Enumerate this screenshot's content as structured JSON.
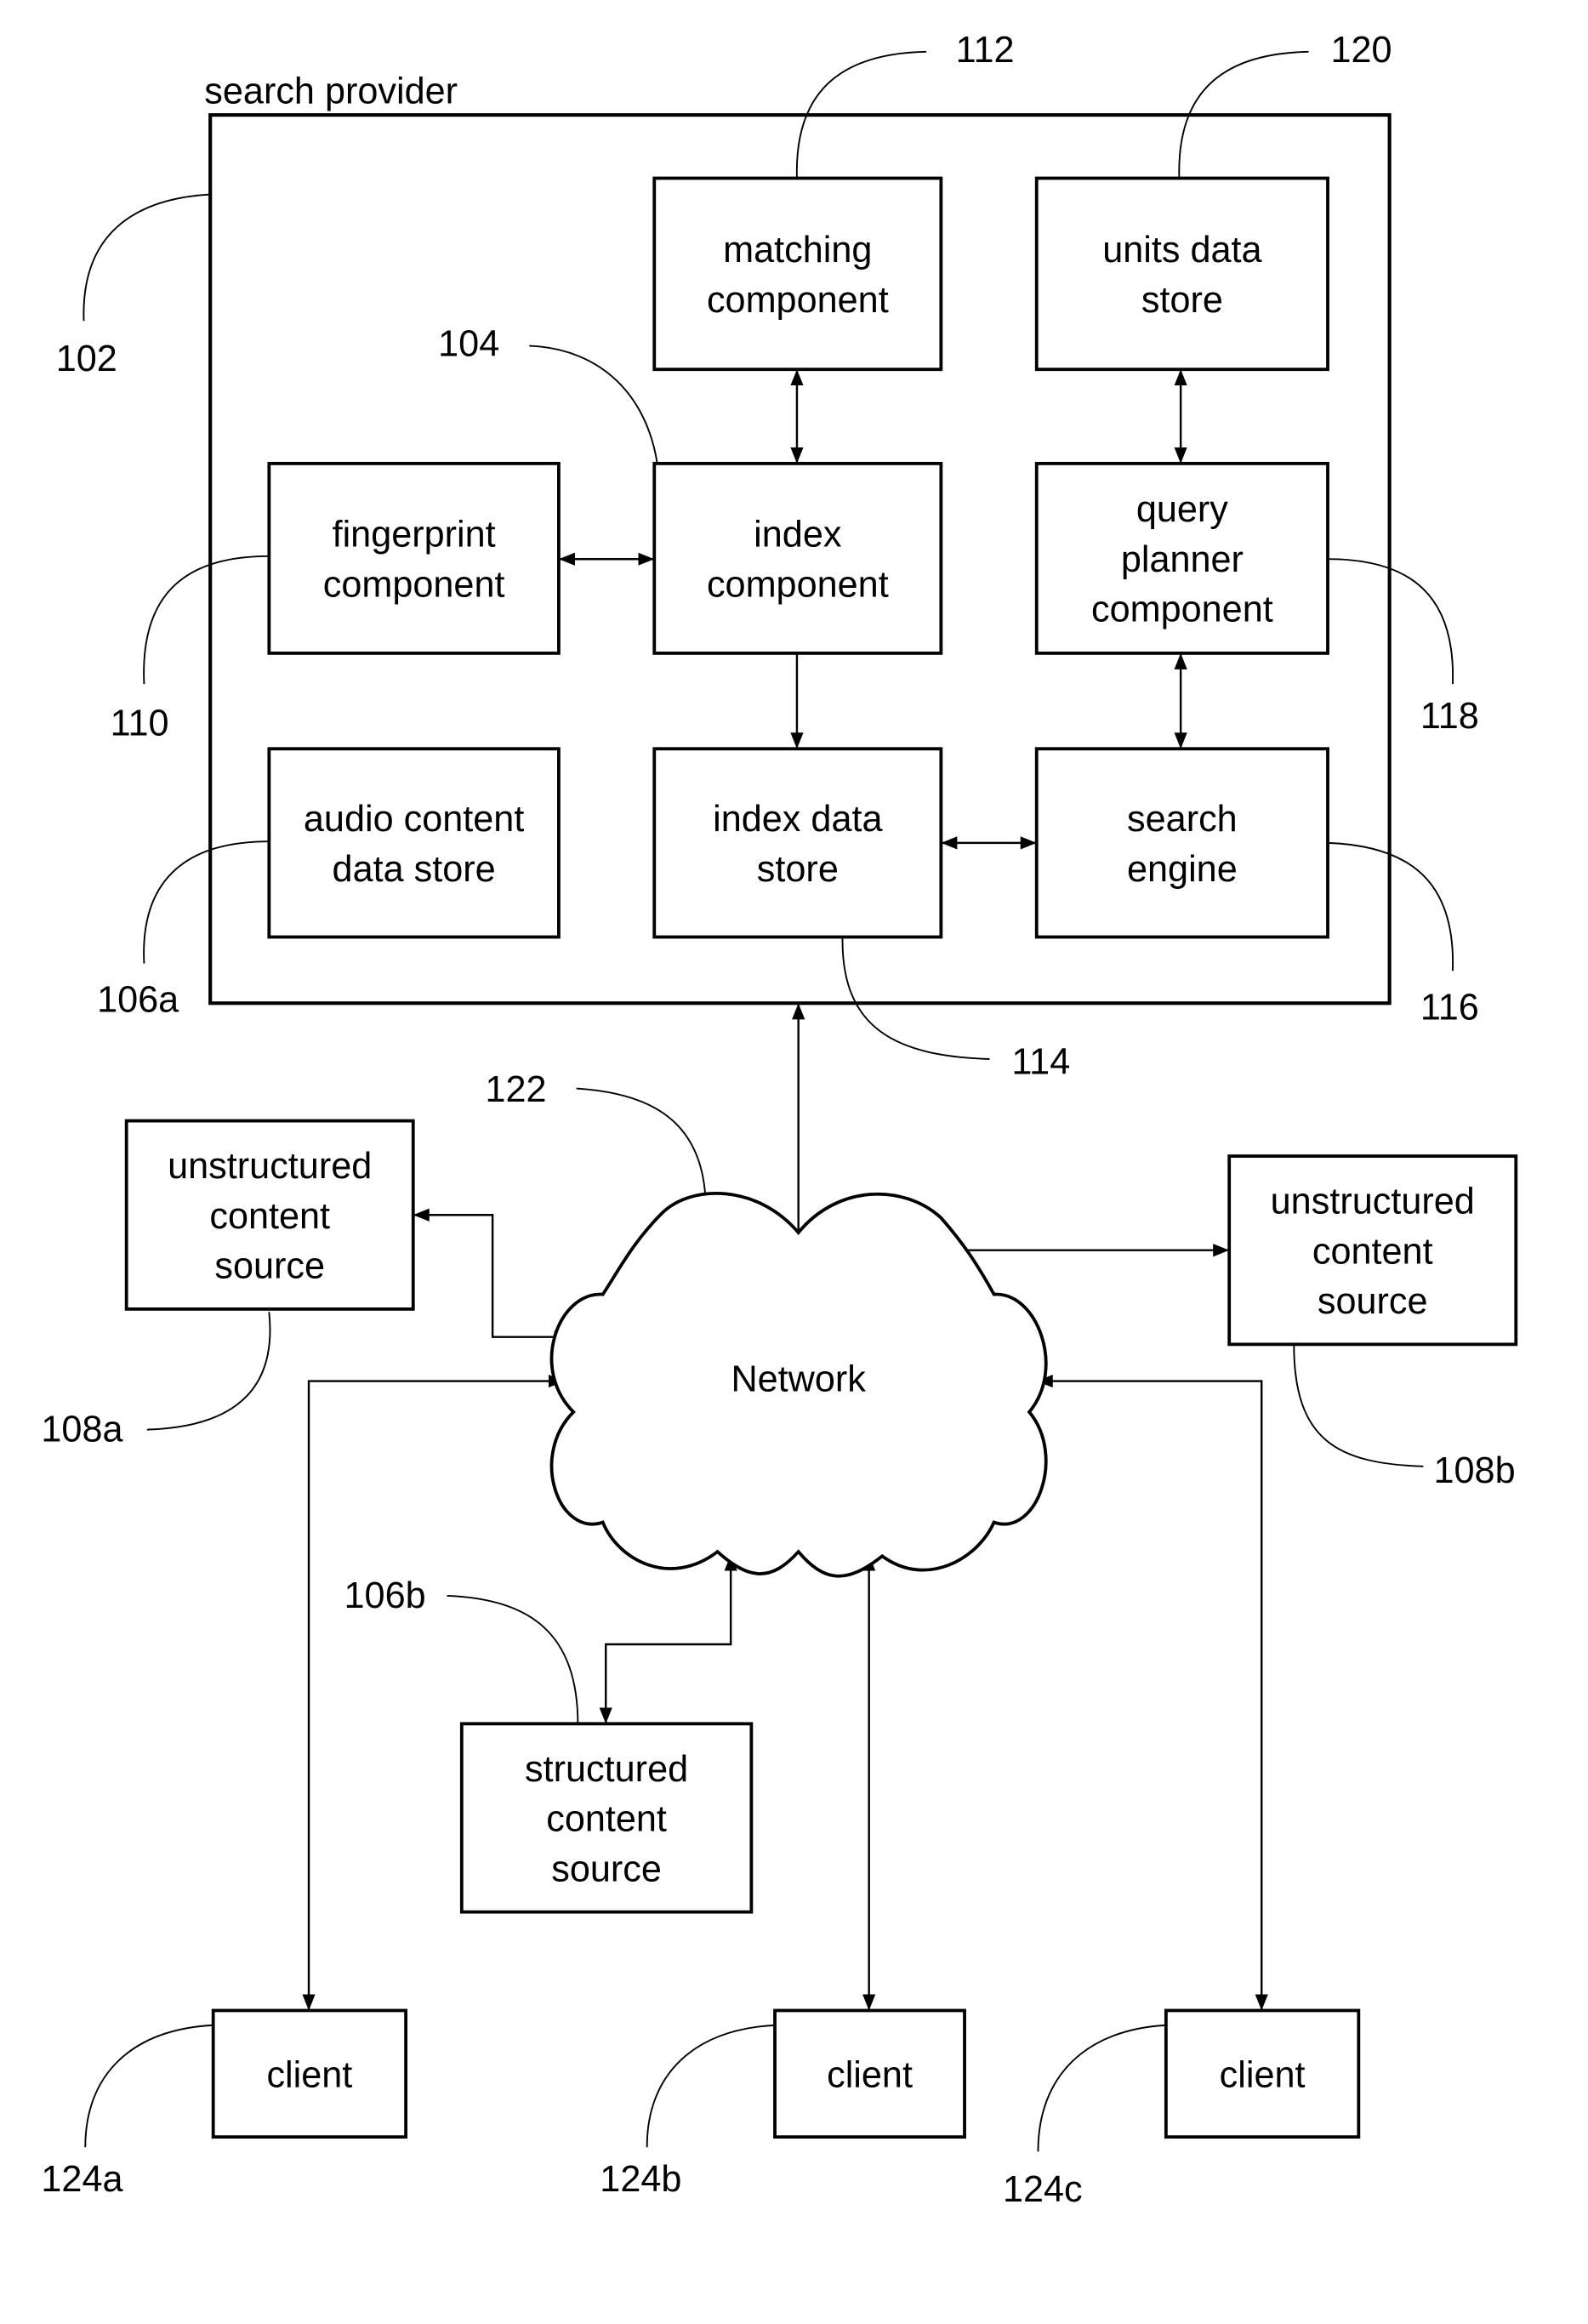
{
  "diagram": {
    "container": {
      "id": "102",
      "label": "search provider"
    },
    "nodes": [
      {
        "id": "112",
        "key": "matching",
        "lines": [
          "matching",
          "component"
        ]
      },
      {
        "id": "120",
        "key": "units",
        "lines": [
          "units data",
          "store"
        ]
      },
      {
        "id": "110",
        "key": "fingerprint",
        "lines": [
          "fingerprint",
          "component"
        ]
      },
      {
        "id": "104",
        "key": "index",
        "lines": [
          "index",
          "component"
        ]
      },
      {
        "id": "118",
        "key": "planner",
        "lines": [
          "query",
          "planner",
          "component"
        ]
      },
      {
        "id": "106a",
        "key": "audio",
        "lines": [
          "audio content",
          "data store"
        ]
      },
      {
        "id": "114",
        "key": "indexstore",
        "lines": [
          "index data",
          "store"
        ]
      },
      {
        "id": "116",
        "key": "engine",
        "lines": [
          "search",
          "engine"
        ]
      },
      {
        "id": "108a",
        "key": "unstructA",
        "lines": [
          "unstructured",
          "content",
          "source"
        ]
      },
      {
        "id": "108b",
        "key": "unstructB",
        "lines": [
          "unstructured",
          "content",
          "source"
        ]
      },
      {
        "id": "106b",
        "key": "structured",
        "lines": [
          "structured",
          "content",
          "source"
        ]
      },
      {
        "id": "124a",
        "key": "clientA",
        "lines": [
          "client"
        ]
      },
      {
        "id": "124b",
        "key": "clientB",
        "lines": [
          "client"
        ]
      },
      {
        "id": "124c",
        "key": "clientC",
        "lines": [
          "client"
        ]
      }
    ],
    "network": {
      "id": "122",
      "label": "Network"
    },
    "edges": [
      {
        "from": "matching",
        "to": "index",
        "dir": "both"
      },
      {
        "from": "units",
        "to": "planner",
        "dir": "both"
      },
      {
        "from": "fingerprint",
        "to": "index",
        "dir": "both"
      },
      {
        "from": "index",
        "to": "indexstore",
        "dir": "forward"
      },
      {
        "from": "planner",
        "to": "engine",
        "dir": "both"
      },
      {
        "from": "indexstore",
        "to": "engine",
        "dir": "both"
      },
      {
        "from": "network",
        "to": "container",
        "dir": "forward"
      },
      {
        "from": "unstructA",
        "to": "network",
        "dir": "both"
      },
      {
        "from": "unstructB",
        "to": "network",
        "dir": "both"
      },
      {
        "from": "structured",
        "to": "network",
        "dir": "both"
      },
      {
        "from": "clientA",
        "to": "network",
        "dir": "both"
      },
      {
        "from": "clientB",
        "to": "network",
        "dir": "both"
      },
      {
        "from": "clientC",
        "to": "network",
        "dir": "both"
      }
    ],
    "reference_numerals": [
      "102",
      "104",
      "106a",
      "106b",
      "108a",
      "108b",
      "110",
      "112",
      "114",
      "116",
      "118",
      "120",
      "122",
      "124a",
      "124b",
      "124c"
    ]
  }
}
